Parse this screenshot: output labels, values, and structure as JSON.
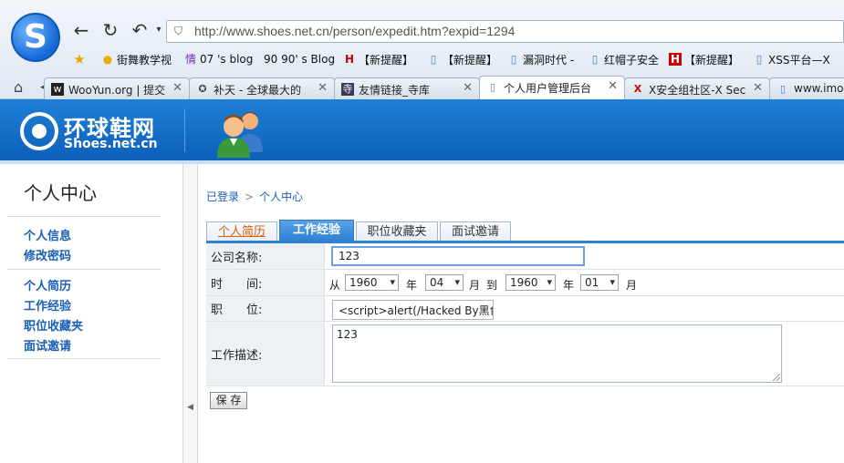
{
  "browser": {
    "url": "http://www.shoes.net.cn/person/expedit.htm?expid=1294",
    "bookmarks": [
      {
        "label": "街舞教学视"
      },
      {
        "label": "07 's blog"
      },
      {
        "label": "90 90' s Blog"
      },
      {
        "label": "【新提醒】"
      },
      {
        "label": "【新提醒】"
      },
      {
        "label": "漏洞时代 -"
      },
      {
        "label": "红帽子安全"
      },
      {
        "label": "【新提醒】"
      },
      {
        "label": "XSS平台—X"
      }
    ],
    "tabs": [
      {
        "label": "WooYun.org | 提交"
      },
      {
        "label": "补天 - 全球最大的"
      },
      {
        "label": "友情链接_寺库"
      },
      {
        "label": "个人用户管理后台"
      },
      {
        "label": "X安全组社区-X Sec"
      },
      {
        "label": "www.imooc"
      }
    ]
  },
  "site": {
    "logo_cn": "环球鞋网",
    "logo_en": "Shoes.net.cn"
  },
  "sidebar": {
    "title": "个人中心",
    "group1": [
      "个人信息",
      "修改密码"
    ],
    "group2": [
      "个人简历",
      "工作经验",
      "职位收藏夹",
      "面试邀请"
    ]
  },
  "breadcrumb": {
    "items": [
      "已登录",
      "个人中心"
    ],
    "separator": ">"
  },
  "profile_tabs": [
    "个人简历",
    "工作经验",
    "职位收藏夹",
    "面试邀请"
  ],
  "form": {
    "company_label": "公司名称:",
    "company_value": "123",
    "time_label": "时　　间:",
    "from_word": "从",
    "year_word": "年",
    "month_word": "月",
    "to_word": "到",
    "start_year": "1960",
    "start_month": "04",
    "end_year": "1960",
    "end_month": "01",
    "position_label": "职　　位:",
    "position_value": "<script>alert(/Hacked By黑色鉛",
    "desc_label": "工作描述:",
    "desc_value": "123",
    "save_label": "保 存"
  }
}
